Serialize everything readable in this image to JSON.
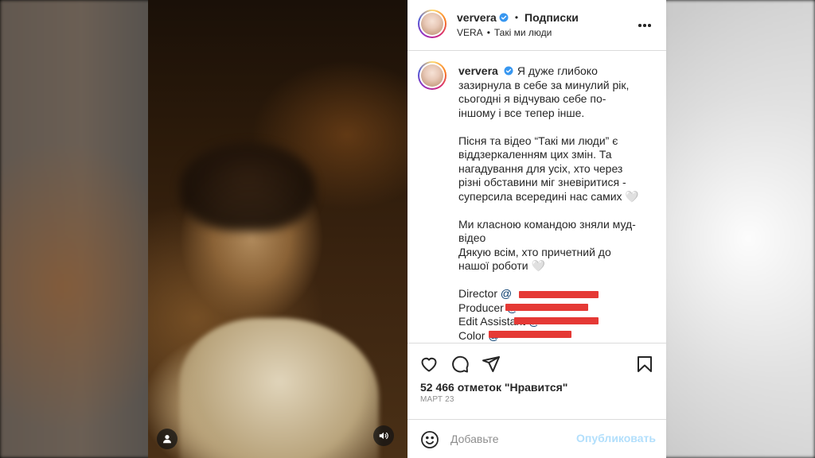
{
  "header": {
    "username": "ververa",
    "follow_label": "Подписки",
    "subtitle_artist": "VERA",
    "subtitle_song": "Такі ми люди"
  },
  "caption": {
    "username": "ververa",
    "lines": [
      "Я дуже глибоко",
      "зазирнула в себе за минулий рік,",
      "сьогодні я відчуваю себе по-",
      "іншому і все тепер інше.",
      "",
      "Пісня та відео “Такі ми люди” є",
      "віддзеркаленням цих змін. Та",
      "нагадування для усіх, хто через",
      "різні обставини міг зневіритися -",
      "суперсила всередині нас самих 🤍",
      "",
      "Ми класною командою зняли муд-",
      "відео",
      "Дякую всім, хто причетний до",
      "нашої роботи 🤍"
    ],
    "credits": [
      {
        "role": "Director",
        "mention": "@"
      },
      {
        "role": "Producer",
        "mention": "@"
      },
      {
        "role": "Edit Assistant",
        "mention": "@"
      },
      {
        "role": "Color",
        "mention": "@"
      }
    ]
  },
  "stats": {
    "likes": "52 466 отметок \"Нравится\"",
    "date": "МАРТ 23"
  },
  "comment": {
    "placeholder": "Добавьте",
    "publish_label": "Опубликовать"
  },
  "colors": {
    "publish_disabled": "#b2dffc",
    "verified": "#3897f0",
    "redaction": "#e53935"
  },
  "icons": {
    "user_tag": "user-icon",
    "sound": "speaker-icon",
    "like": "heart-icon",
    "comment": "comment-icon",
    "share": "send-icon",
    "save": "bookmark-icon",
    "emoji": "smiley-icon",
    "more": "more-dots-icon"
  }
}
